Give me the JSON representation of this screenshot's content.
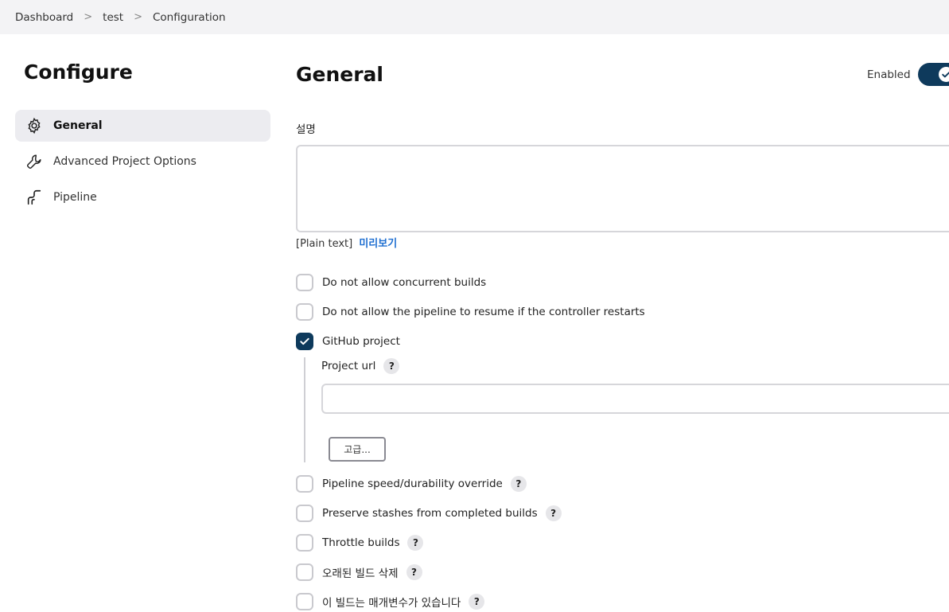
{
  "breadcrumb": {
    "items": [
      "Dashboard",
      "test",
      "Configuration"
    ],
    "separator": ">"
  },
  "sidebar": {
    "title": "Configure",
    "items": [
      {
        "label": "General",
        "icon": "gear-icon",
        "active": true
      },
      {
        "label": "Advanced Project Options",
        "icon": "wrench-icon",
        "active": false
      },
      {
        "label": "Pipeline",
        "icon": "pipeline-icon",
        "active": false
      }
    ]
  },
  "main": {
    "title": "General",
    "enabled_label": "Enabled",
    "enabled": true,
    "description_label": "설명",
    "description_value": "",
    "plain_text_label": "[Plain text]",
    "preview_link": "미리보기",
    "options": [
      {
        "label": "Do not allow concurrent builds",
        "checked": false,
        "help": false
      },
      {
        "label": "Do not allow the pipeline to resume if the controller restarts",
        "checked": false,
        "help": false
      },
      {
        "label": "GitHub project",
        "checked": true,
        "help": false
      },
      {
        "label": "Pipeline speed/durability override",
        "checked": false,
        "help": true
      },
      {
        "label": "Preserve stashes from completed builds",
        "checked": false,
        "help": true
      },
      {
        "label": "Throttle builds",
        "checked": false,
        "help": true
      },
      {
        "label": "오래된 빌드 삭제",
        "checked": false,
        "help": true
      },
      {
        "label": "이 빌드는 매개변수가 있습니다",
        "checked": false,
        "help": true
      }
    ],
    "github": {
      "project_url_label": "Project url",
      "project_url_value": "",
      "advanced_button": "고급...",
      "help_symbol": "?"
    },
    "help_symbol": "?"
  },
  "colors": {
    "accent": "#0e3a5c",
    "link": "#1f6fd1",
    "breadcrumb_bg": "#f3f3f5",
    "active_item_bg": "#ececf0"
  }
}
